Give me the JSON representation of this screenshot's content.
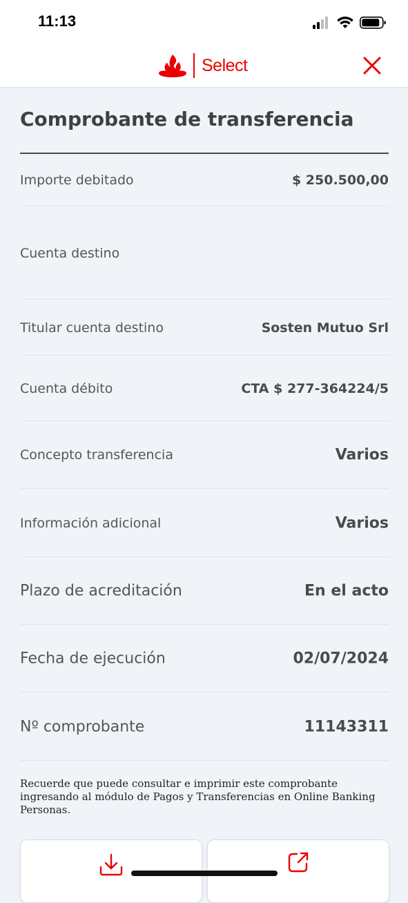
{
  "status_bar": {
    "time": "11:13"
  },
  "header": {
    "brand_name": "Select"
  },
  "receipt": {
    "title": "Comprobante de transferencia",
    "rows": [
      {
        "label": "Importe debitado",
        "value": "$ 250.500,00"
      },
      {
        "label": "Cuenta destino",
        "value": ""
      },
      {
        "label": "Titular cuenta destino",
        "value": "Sosten Mutuo Srl"
      },
      {
        "label": "Cuenta débito",
        "value": "CTA $ 277-364224/5"
      },
      {
        "label": "Concepto transferencia",
        "value": "Varios"
      },
      {
        "label": "Información adicional",
        "value": "Varios"
      },
      {
        "label": "Plazo de acreditación",
        "value": "En el acto"
      },
      {
        "label": "Fecha de ejecución",
        "value": "02/07/2024"
      },
      {
        "label": "Nº comprobante",
        "value": "11143311"
      }
    ],
    "disclaimer": "Recuerde que puede consultar e imprimir este comprobante ingresando al módulo de Pagos y Transferencias en Online Banking Personas."
  },
  "icons": {
    "download": "download-icon",
    "share": "share-icon",
    "close": "close-icon",
    "brand": "santander-flame-icon"
  },
  "colors": {
    "accent": "#ec0000",
    "background": "#f0f4f8"
  }
}
